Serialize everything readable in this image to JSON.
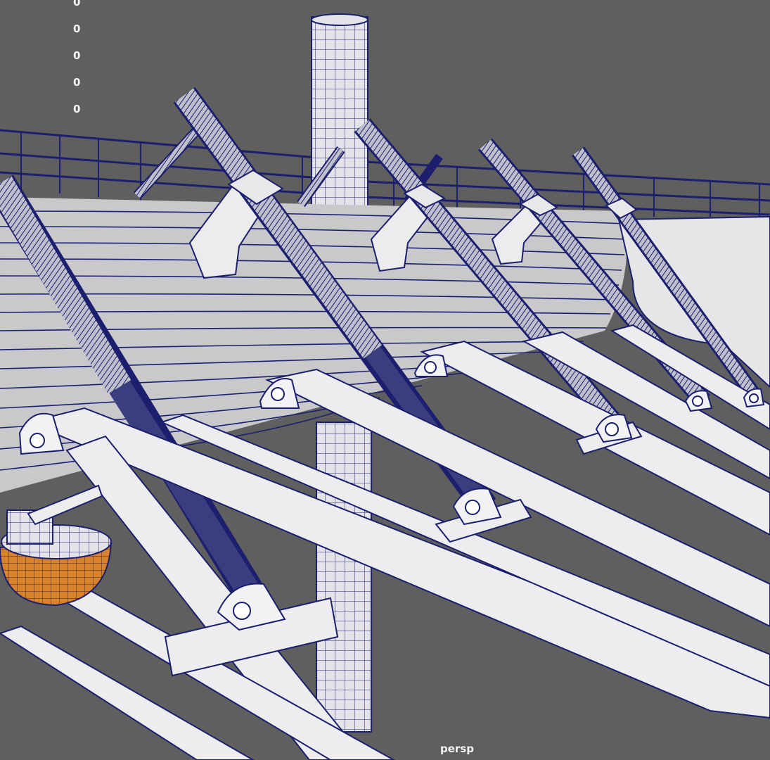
{
  "viewport": {
    "camera_label": "persp",
    "hud_stats": [
      "0",
      "0",
      "0",
      "0",
      "0"
    ]
  },
  "colors": {
    "background": "#5f5f5f",
    "wireframe": "#1c1f6e",
    "surface": "#d8d8da",
    "selected_accent": "#d9822b"
  },
  "icons": {
    "camera": "persp-view"
  }
}
